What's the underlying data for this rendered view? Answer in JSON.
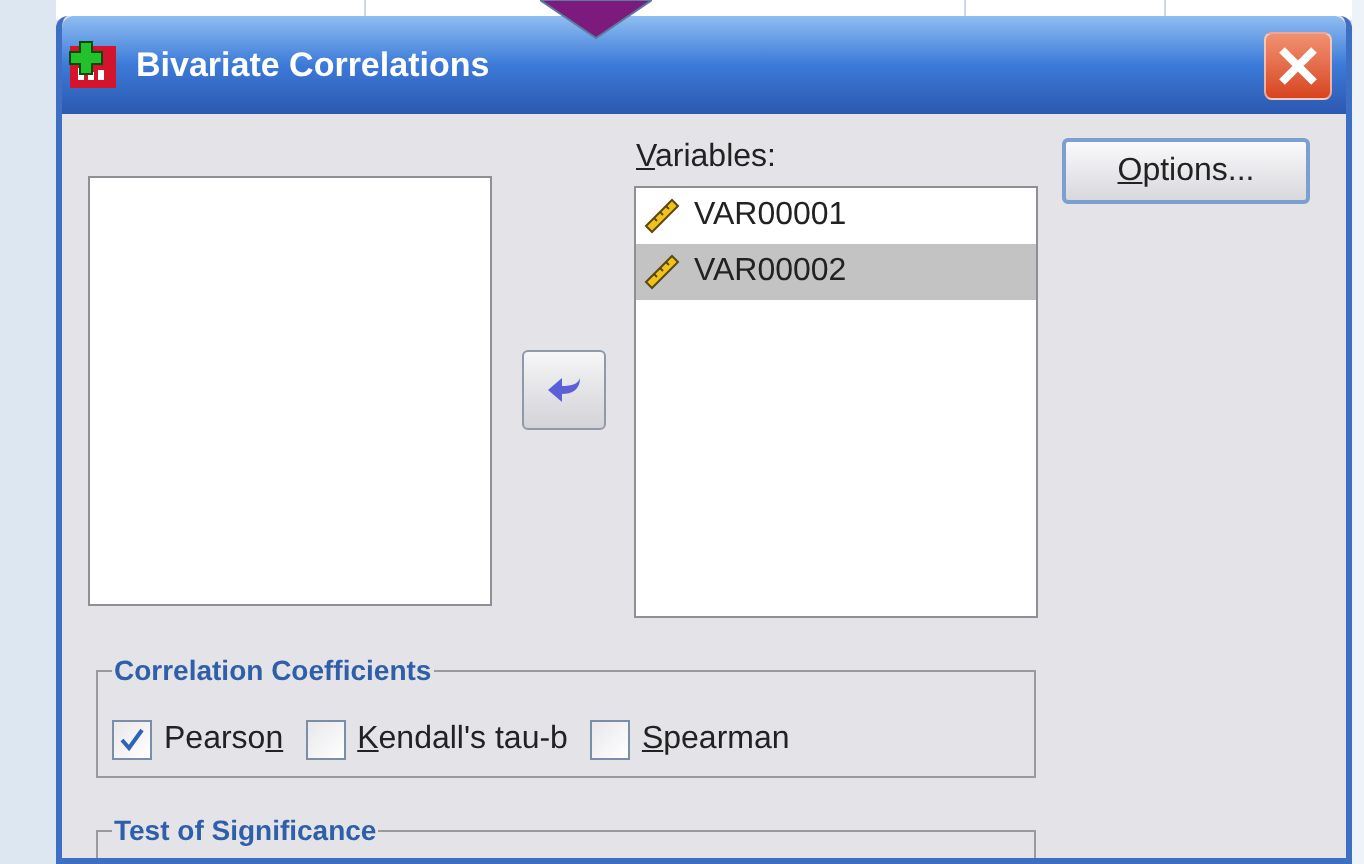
{
  "window": {
    "title": "Bivariate Correlations"
  },
  "variables": {
    "label": {
      "key": "V",
      "rest": "ariables:"
    },
    "items": [
      {
        "name": "VAR00001",
        "selected": false
      },
      {
        "name": "VAR00002",
        "selected": true
      }
    ]
  },
  "options_button": {
    "key": "O",
    "rest": "ptions..."
  },
  "correlation_coefficients": {
    "title": "Correlation Coefficients",
    "options": [
      {
        "lead": "Pearso",
        "key": "n",
        "checked": true
      },
      {
        "key": "K",
        "rest": "endall's tau-b",
        "checked": false
      },
      {
        "key": "S",
        "rest": "pearman",
        "checked": false
      }
    ]
  },
  "test_of_significance": {
    "title": "Test of Significance"
  }
}
